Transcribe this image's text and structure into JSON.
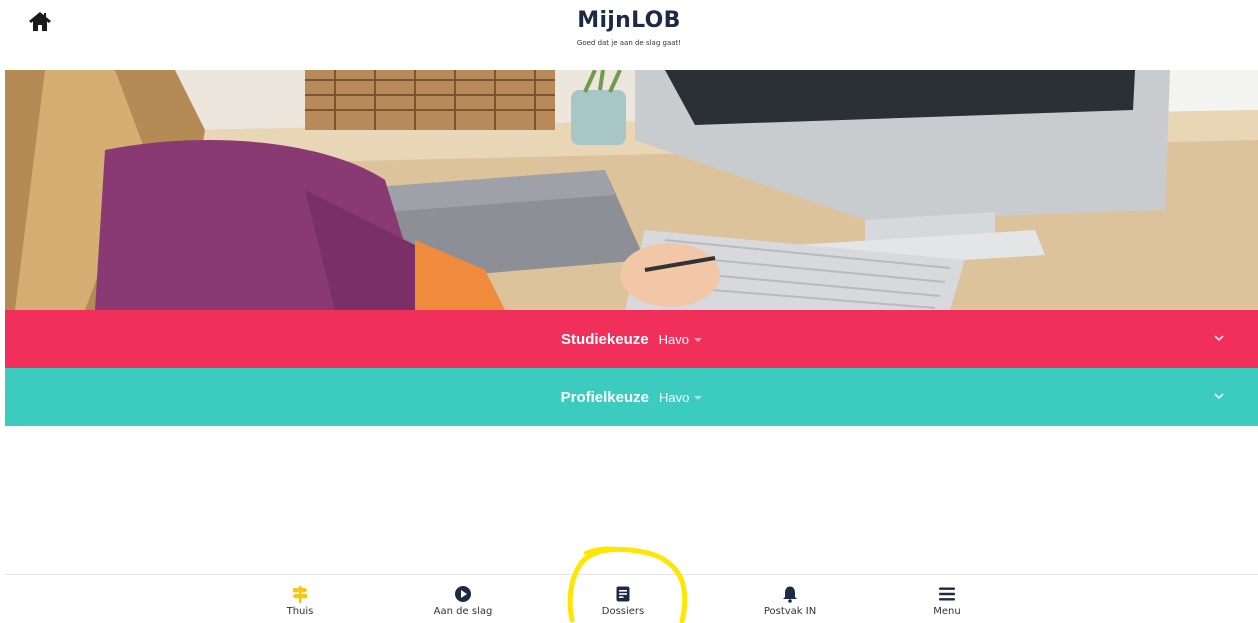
{
  "header": {
    "title": "MijnLOB",
    "subtitle": "Goed dat je aan de slag gaat!"
  },
  "hero": {
    "image": "student-at-desk-with-computer"
  },
  "accordions": [
    {
      "label": "Studiekeuze",
      "selected": "Havo",
      "color": "#f0305a"
    },
    {
      "label": "Profielkeuze",
      "selected": "Havo",
      "color": "#3ccbbf"
    }
  ],
  "bottom_nav": {
    "items": [
      {
        "label": "Thuis",
        "icon": "signpost-icon",
        "active": true,
        "color": "#f5c518"
      },
      {
        "label": "Aan de slag",
        "icon": "play-circle-icon"
      },
      {
        "label": "Dossiers",
        "icon": "document-icon"
      },
      {
        "label": "Postvak IN",
        "icon": "bell-icon"
      },
      {
        "label": "Menu",
        "icon": "hamburger-icon"
      }
    ]
  },
  "annotation": {
    "color": "#ffe600"
  }
}
